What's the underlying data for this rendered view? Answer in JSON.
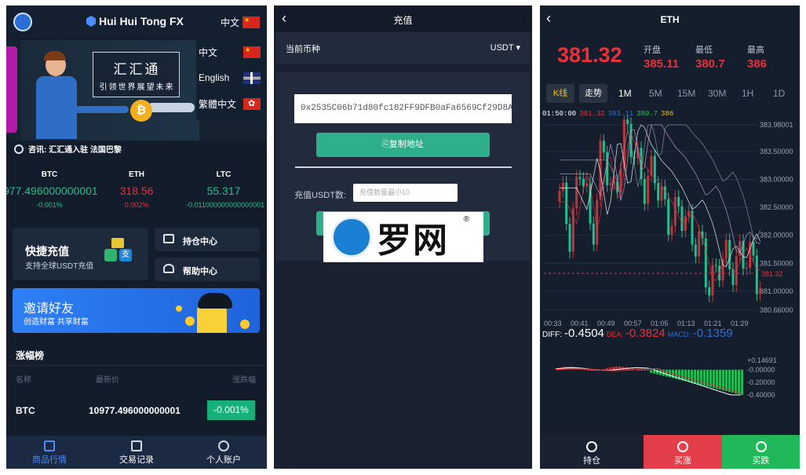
{
  "home": {
    "brand": "Hui Hui Tong FX",
    "lang_current": "中文",
    "lang_options": [
      "中文",
      "English",
      "繁體中文"
    ],
    "banner": {
      "title": "汇汇通",
      "subtitle": "引领世界展望未来"
    },
    "news": "咨讯: 汇汇通入驻 法国巴黎",
    "tickers": [
      {
        "name": "BTC",
        "price": "977.496000000001",
        "pct": "-0.001%",
        "color": "#1fc08b"
      },
      {
        "name": "ETH",
        "price": "318.56",
        "pct": "0.002%",
        "color": "#e8313b"
      },
      {
        "name": "LTC",
        "price": "55.317",
        "pct": "-0.011000000000000001",
        "color": "#1fc08b"
      }
    ],
    "quick_deposit": {
      "title": "快捷充值",
      "subtitle": "支持全球USDT充值",
      "alipay": "支"
    },
    "side_buttons": [
      "持仓中心",
      "帮助中心"
    ],
    "invite": {
      "title": "邀请好友",
      "subtitle": "创造财富 共享财富"
    },
    "ranking": {
      "title": "涨幅榜",
      "headers": [
        "名称",
        "最新价",
        "涨跌幅"
      ],
      "rows": [
        {
          "name": "BTC",
          "price": "10977.496000000001",
          "pct": "-0.001%"
        }
      ]
    },
    "tabs": [
      "商品行情",
      "交易记录",
      "个人账户"
    ]
  },
  "deposit": {
    "title": "充值",
    "currency_label": "当前币种",
    "currency_value": "USDT",
    "address": "0x2535C06b71d80fc182FF9DFB0aFa6569Cf29D8A9",
    "copy_label": "复制地址",
    "amount_label": "充值USDT数:",
    "amount_placeholder": "充值数量最小10",
    "watermark": "罗网",
    "watermark_mark": "®"
  },
  "chart": {
    "title": "ETH",
    "price": "381.32",
    "stats": [
      {
        "label": "开盘",
        "value": "385.11"
      },
      {
        "label": "最低",
        "value": "380.7"
      },
      {
        "label": "最高",
        "value": "386"
      }
    ],
    "chart_type_tabs": [
      "K线",
      "走势"
    ],
    "timeframes": [
      "1M",
      "5M",
      "15M",
      "30M",
      "1H",
      "1D"
    ],
    "active_timeframe": "1M",
    "ma_time": "01:50:00",
    "ma_values": [
      "381.32",
      "383.11",
      "380.7",
      "386"
    ],
    "ma_colors": [
      "#e8313b",
      "#2f6ed6",
      "#2fbf5b",
      "#f0c419"
    ],
    "y_ticks": [
      "383.98001",
      "383.50000",
      "383.00000",
      "382.50000",
      "382.00000",
      "381.50000",
      "381.00000",
      "380.66000"
    ],
    "x_ticks": [
      "00:33",
      "00:41",
      "00:49",
      "00:57",
      "01:05",
      "01:13",
      "01:21",
      "01:29"
    ],
    "last_price_tag": "381.32",
    "diff_label": "DIFF:",
    "diff_value": "-0.4504",
    "dea_label": "DEA:",
    "dea_value": "-0.3824",
    "macd_label": "MACD:",
    "macd_value": "-0.1359",
    "macd_ticks": [
      "+0.14691",
      "-0.00000",
      "-0.20000",
      "-0.40000"
    ],
    "bottom_buttons": [
      "持仓",
      "买涨",
      "买跌"
    ],
    "colors": {
      "up": "#e8313b",
      "down": "#1fbf8f",
      "buy_up_bg": "#e53e4b",
      "buy_down_bg": "#21b85a"
    }
  },
  "chart_data": {
    "type": "candlestick",
    "title": "ETH 1M",
    "ylim": [
      380.66,
      383.98001
    ],
    "x": [
      "00:33",
      "00:41",
      "00:49",
      "00:57",
      "01:05",
      "01:13",
      "01:21",
      "01:29"
    ],
    "close_series": [
      382.6,
      382.2,
      383.2,
      382.0,
      383.6,
      382.5,
      383.9,
      383.4,
      383.1,
      382.9,
      382.6,
      382.2,
      382.4,
      381.9,
      381.1,
      381.6,
      381.3,
      381.8,
      381.4,
      381.32
    ],
    "macd": {
      "diff": -0.4504,
      "dea": -0.3824,
      "macd": -0.1359,
      "ylim": [
        -0.4,
        0.14691
      ]
    }
  }
}
